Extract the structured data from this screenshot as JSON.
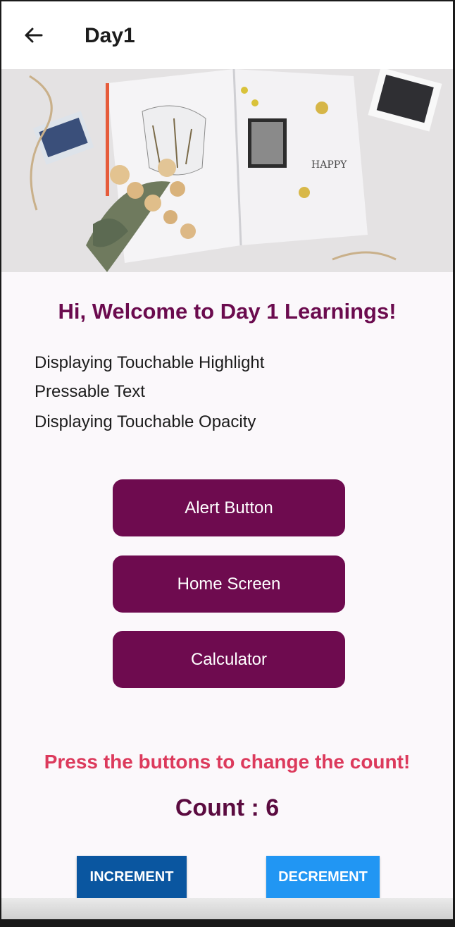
{
  "header": {
    "title": "Day1",
    "back_icon": "arrow-left-icon"
  },
  "hero": {
    "subject": "journal-flatlay-photo"
  },
  "welcome": "Hi, Welcome to Day 1 Learnings!",
  "text_lines": [
    "Displaying Touchable Highlight",
    "Pressable Text",
    "Displaying Touchable Opacity"
  ],
  "menu_buttons": [
    "Alert Button",
    "Home Screen",
    "Calculator"
  ],
  "prompt": "Press the buttons to change the count!",
  "counter": {
    "label": "Count : ",
    "value": "6"
  },
  "actions": {
    "increment": "INCREMENT",
    "decrement": "DECREMENT"
  },
  "colors": {
    "primary": "#6e0b4f",
    "prompt": "#dc3a5c",
    "increment_bg": "#0a56a0",
    "decrement_bg": "#2196f3"
  }
}
